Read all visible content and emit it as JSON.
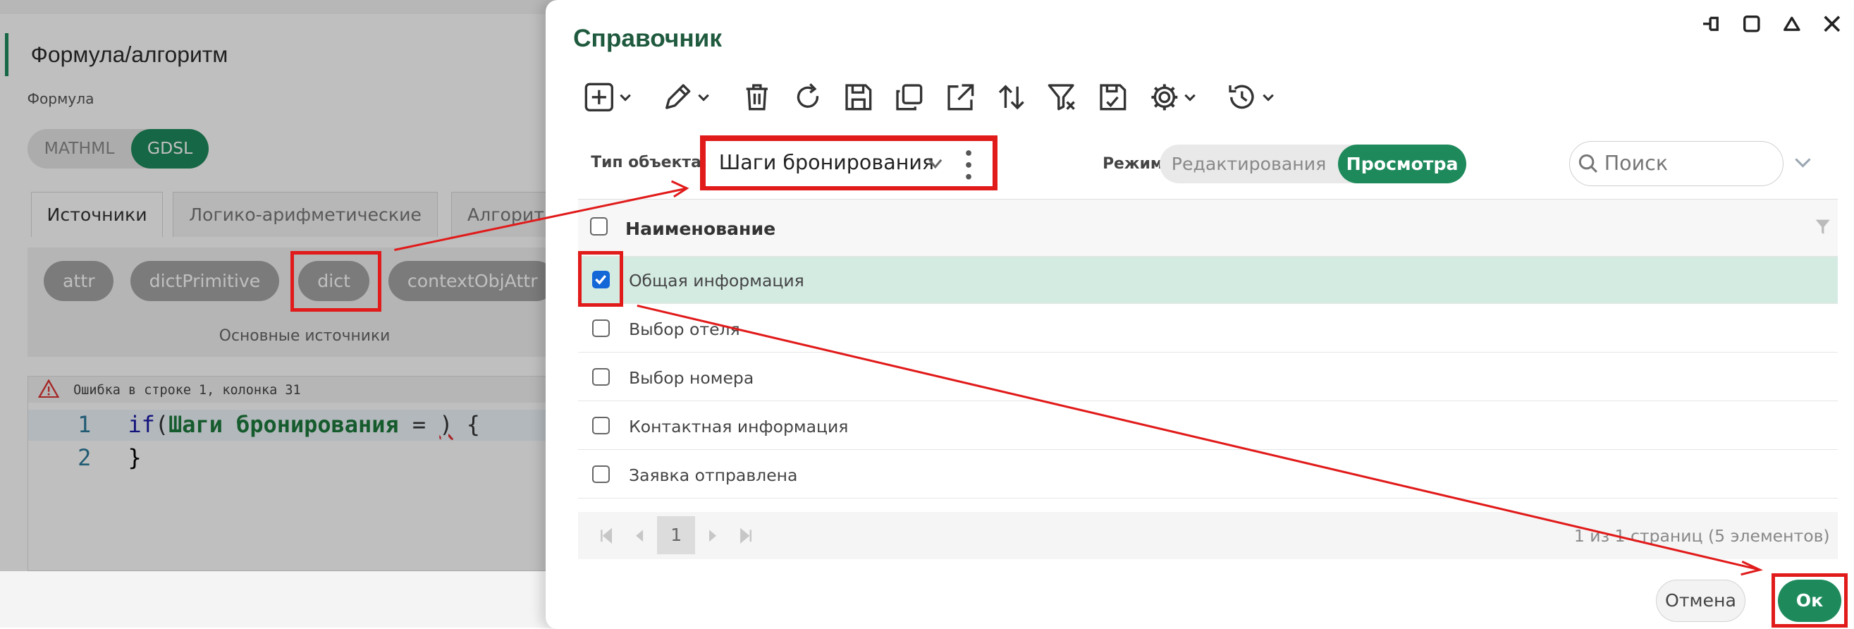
{
  "background_panel": {
    "title": "Формула/алгоритм",
    "formula_label": "Формула",
    "formula_modes": [
      "MATHML",
      "GDSL"
    ],
    "tabs": [
      "Источники",
      "Логико-арифметические",
      "Алгорит"
    ],
    "sources": [
      "attr",
      "dictPrimitive",
      "dict",
      "contextObjAttr"
    ],
    "sources_caption": "Основные источники",
    "error_text": "Ошибка в строке 1, колонка 31",
    "code": {
      "line_numbers": [
        "1",
        "2"
      ],
      "line1_kw": "if",
      "line1_paren_open": "(",
      "line1_ident": "Шаги бронирования",
      "line1_eq": " = ",
      "line1_paren_close": ")",
      "line1_brace": " {",
      "line2": "}"
    }
  },
  "dialog": {
    "title": "Справочник",
    "toolbar_icons": [
      "add-icon",
      "edit-icon",
      "delete-icon",
      "refresh-icon",
      "save-icon",
      "copy-icon",
      "export-icon",
      "sort-icon",
      "clear-filter-icon",
      "save-view-icon",
      "settings-icon",
      "history-icon"
    ],
    "object_type_label": "Тип объекта:",
    "object_type_value": "Шаги бронирования",
    "mode_label": "Режим",
    "mode_options": [
      "Редактирования",
      "Просмотра"
    ],
    "mode_selected": "Просмотра",
    "search_placeholder": "Поиск",
    "column_header": "Наименование",
    "rows": [
      {
        "label": "Общая информация",
        "checked": true
      },
      {
        "label": "Выбор отеля",
        "checked": false
      },
      {
        "label": "Выбор номера",
        "checked": false
      },
      {
        "label": "Контактная информация",
        "checked": false
      },
      {
        "label": "Заявка отправлена",
        "checked": false
      }
    ],
    "pager": {
      "current_page": "1",
      "info": "1 из 1 страниц (5 элементов)"
    },
    "cancel_label": "Отмена",
    "ok_label": "Ок"
  },
  "colors": {
    "accent": "#1e8a5c",
    "annotation": "#e11a1a",
    "selected_row": "#d4ebe2",
    "title": "#1f5a3e"
  }
}
